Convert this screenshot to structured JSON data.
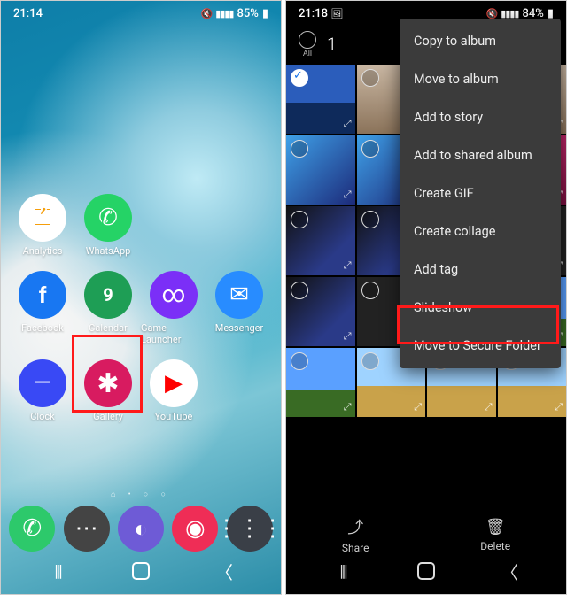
{
  "left": {
    "status": {
      "time": "21:14",
      "mute_icon": "🔇",
      "signal": "▮▮▮▮",
      "battery_pct": "85%",
      "battery_icon": "▮"
    },
    "apps_row1": [
      {
        "name": "analytics",
        "label": "Analytics",
        "glyph": "⏍"
      },
      {
        "name": "whatsapp",
        "label": "WhatsApp",
        "glyph": "✆"
      }
    ],
    "apps_row2": [
      {
        "name": "facebook",
        "label": "Facebook",
        "glyph": "f"
      },
      {
        "name": "calendar",
        "label": "Calendar",
        "glyph": "9"
      },
      {
        "name": "gamelauncher",
        "label": "Game Launcher",
        "glyph": "∞"
      },
      {
        "name": "messenger",
        "label": "Messenger",
        "glyph": "✉"
      }
    ],
    "apps_row3": [
      {
        "name": "clock",
        "label": "Clock",
        "glyph": "—"
      },
      {
        "name": "gallery",
        "label": "Gallery",
        "glyph": "✱"
      },
      {
        "name": "youtube",
        "label": "YouTube",
        "glyph": "▶"
      }
    ],
    "dock": [
      {
        "name": "phone",
        "glyph": "✆"
      },
      {
        "name": "messages",
        "glyph": "⋯"
      },
      {
        "name": "internet",
        "glyph": "◐"
      },
      {
        "name": "camera",
        "glyph": "◉"
      },
      {
        "name": "apps-drawer",
        "glyph": "⋮⋮⋮"
      }
    ],
    "page_dots": "⌂ • ○ ○",
    "highlight": "gallery"
  },
  "right": {
    "status": {
      "time": "21:18",
      "extra_icon": "🖼",
      "mute_icon": "🔇",
      "signal": "▮▮▮▮",
      "battery_pct": "84%",
      "battery_icon": "▮"
    },
    "selection": {
      "all_label": "All",
      "count": "1"
    },
    "menu_items": [
      "Copy to album",
      "Move to album",
      "Add to story",
      "Add to shared album",
      "Create GIF",
      "Create collage",
      "Add tag",
      "Slideshow",
      "Move to Secure Folder"
    ],
    "highlight_menu_index": 8,
    "thumbs": [
      {
        "cls": "t-sea",
        "selected": true
      },
      {
        "cls": "t-desk",
        "selected": false
      },
      {
        "cls": "t-desk",
        "selected": false
      },
      {
        "cls": "t-desk",
        "selected": false
      },
      {
        "cls": "t-phone1",
        "selected": false
      },
      {
        "cls": "t-phone1",
        "selected": false
      },
      {
        "cls": "t-phone2",
        "selected": false
      },
      {
        "cls": "t-phone2",
        "selected": false
      },
      {
        "cls": "t-phone3",
        "selected": false
      },
      {
        "cls": "t-phone3",
        "selected": false
      },
      {
        "cls": "t-apps",
        "selected": false
      },
      {
        "cls": "t-apps",
        "selected": false
      },
      {
        "cls": "t-phone3",
        "selected": false
      },
      {
        "cls": "t-apps",
        "selected": false
      },
      {
        "cls": "t-sky",
        "selected": false
      },
      {
        "cls": "t-sky",
        "selected": false
      },
      {
        "cls": "t-sky",
        "selected": false
      },
      {
        "cls": "t-field",
        "selected": false
      },
      {
        "cls": "t-field",
        "selected": false
      },
      {
        "cls": "t-field",
        "selected": false
      }
    ],
    "actions": {
      "share": "Share",
      "delete": "Delete"
    }
  }
}
